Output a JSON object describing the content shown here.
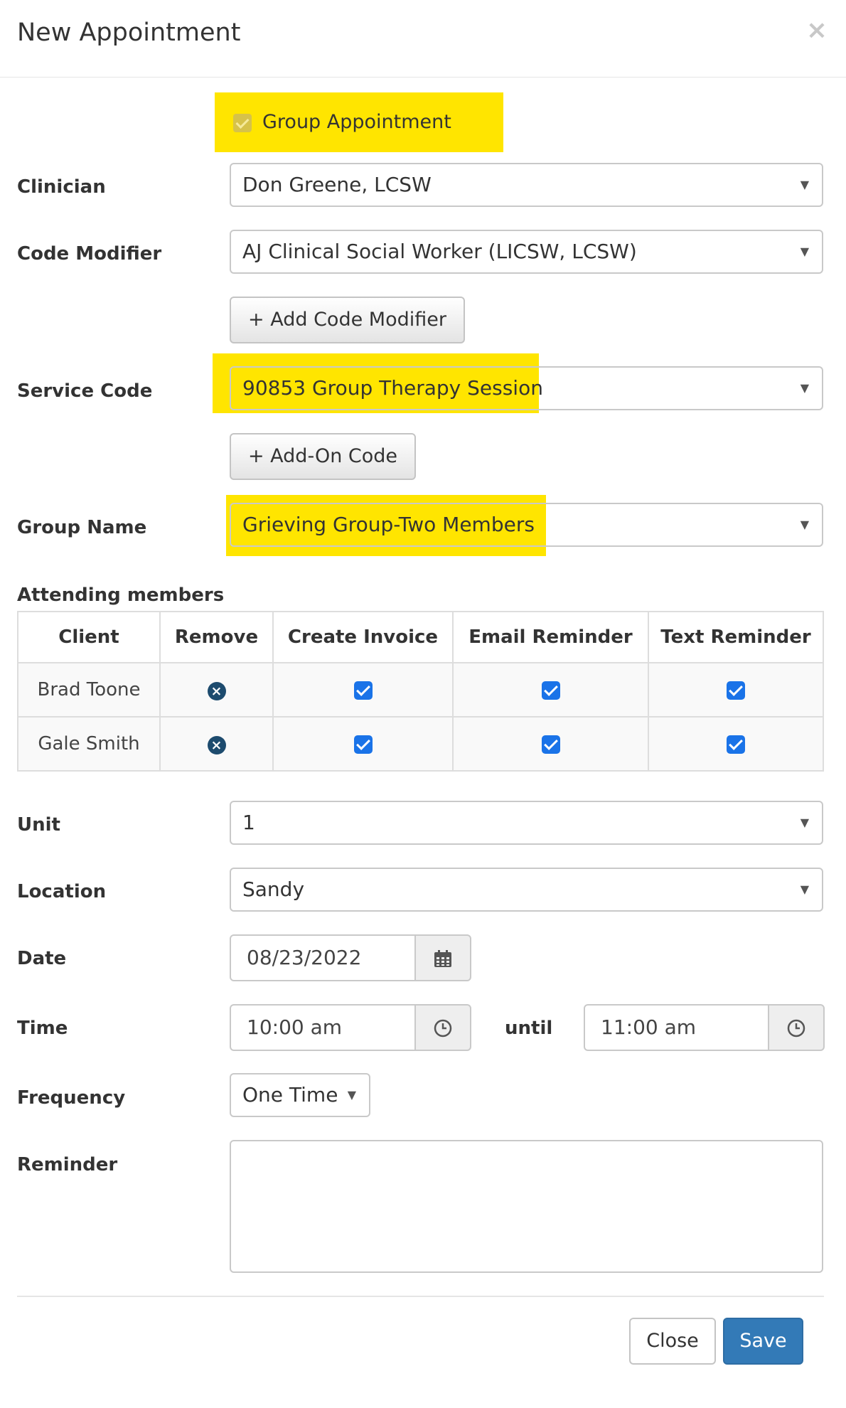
{
  "modal": {
    "title": "New Appointment",
    "close_icon": "×"
  },
  "group_appointment": {
    "label": "Group Appointment",
    "checked": true
  },
  "fields": {
    "clinician": {
      "label": "Clinician",
      "value": "Don Greene, LCSW"
    },
    "code_modifier": {
      "label": "Code Modifier",
      "value": "AJ Clinical Social Worker (LICSW, LCSW)"
    },
    "add_code_modifier": "+ Add Code Modifier",
    "service_code": {
      "label": "Service Code",
      "value": "90853 Group Therapy Session"
    },
    "add_on_code": "+ Add-On Code",
    "group_name": {
      "label": "Group Name",
      "value": "Grieving Group-Two Members"
    },
    "unit": {
      "label": "Unit",
      "value": "1"
    },
    "location": {
      "label": "Location",
      "value": "Sandy"
    },
    "date": {
      "label": "Date",
      "value": "08/23/2022"
    },
    "time": {
      "label": "Time",
      "start": "10:00 am",
      "until_label": "until",
      "end": "11:00 am"
    },
    "frequency": {
      "label": "Frequency",
      "value": "One Time"
    },
    "reminder": {
      "label": "Reminder",
      "value": ""
    }
  },
  "attending": {
    "title": "Attending members",
    "columns": [
      "Client",
      "Remove",
      "Create Invoice",
      "Email Reminder",
      "Text Reminder"
    ],
    "rows": [
      {
        "client": "Brad Toone",
        "create_invoice": true,
        "email_reminder": true,
        "text_reminder": true
      },
      {
        "client": "Gale Smith",
        "create_invoice": true,
        "email_reminder": true,
        "text_reminder": true
      }
    ]
  },
  "buttons": {
    "close": "Close",
    "save": "Save"
  },
  "colors": {
    "highlight": "#ffe500",
    "primary": "#337ab7",
    "checkbox": "#1a73e8",
    "remove_icon": "#1d4b6e"
  },
  "icons": {
    "select_caret": "▼",
    "calendar": "calendar-icon",
    "clock": "clock-icon",
    "remove": "remove-circle-icon"
  }
}
